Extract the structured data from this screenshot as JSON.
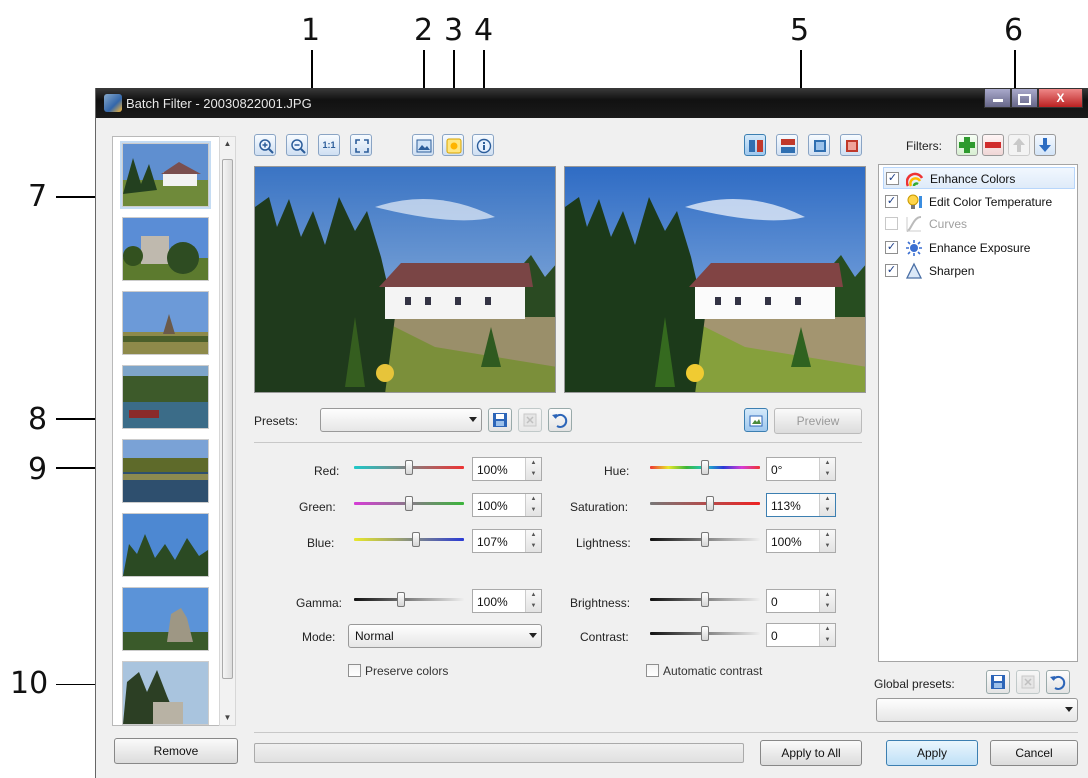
{
  "callouts": [
    "1",
    "2",
    "3",
    "4",
    "5",
    "6",
    "7",
    "8",
    "9",
    "10"
  ],
  "window": {
    "title": "Batch Filter - 20030822001.JPG",
    "close_glyph": "X"
  },
  "toolbar": {
    "zoom_in_icon": "zoom-in-icon",
    "zoom_out_icon": "zoom-out-icon",
    "actual_size_label": "1:1",
    "fit_icon": "fit-to-window-icon"
  },
  "presets": {
    "label": "Presets:",
    "value": "",
    "preview_label": "Preview"
  },
  "color": {
    "red": {
      "label": "Red:",
      "value": "100%",
      "level": 0.5
    },
    "green": {
      "label": "Green:",
      "value": "100%",
      "level": 0.5
    },
    "blue": {
      "label": "Blue:",
      "value": "107%",
      "level": 0.57
    },
    "gamma": {
      "label": "Gamma:",
      "value": "100%",
      "level": 0.42
    },
    "mode_label": "Mode:",
    "mode_value": "Normal",
    "preserve_colors": "Preserve colors"
  },
  "hsl": {
    "hue": {
      "label": "Hue:",
      "value": "0°",
      "level": 0.5
    },
    "saturation": {
      "label": "Saturation:",
      "value": "113%",
      "level": 0.55
    },
    "lightness": {
      "label": "Lightness:",
      "value": "100%",
      "level": 0.5
    },
    "brightness": {
      "label": "Brightness:",
      "value": "0",
      "level": 0.5
    },
    "contrast": {
      "label": "Contrast:",
      "value": "0",
      "level": 0.5
    },
    "automatic_contrast": "Automatic contrast"
  },
  "filters": {
    "label": "Filters:",
    "items": [
      {
        "name": "Enhance Colors",
        "checked": true,
        "icon": "rainbow-icon"
      },
      {
        "name": "Edit Color Temperature",
        "checked": true,
        "icon": "bulb-icon"
      },
      {
        "name": "Curves",
        "checked": false,
        "icon": "curves-icon"
      },
      {
        "name": "Enhance Exposure",
        "checked": true,
        "icon": "sun-icon"
      },
      {
        "name": "Sharpen",
        "checked": true,
        "icon": "triangle-icon"
      }
    ]
  },
  "global_presets": {
    "label": "Global presets:",
    "value": ""
  },
  "buttons": {
    "remove": "Remove",
    "apply_all": "Apply to All",
    "apply": "Apply",
    "cancel": "Cancel"
  },
  "colors": {
    "accent": "#3c7fb1",
    "sky": "#4a86c6",
    "grass": "#7b8f3a"
  }
}
